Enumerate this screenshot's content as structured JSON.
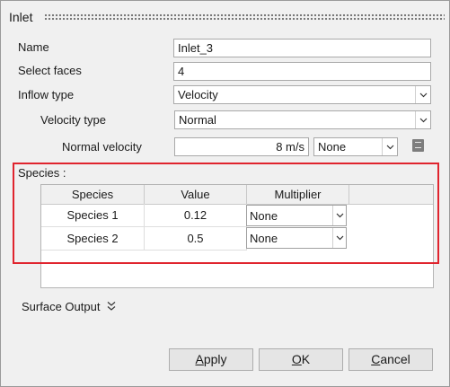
{
  "dialog": {
    "title": "Inlet"
  },
  "form": {
    "name_label": "Name",
    "name_value": "Inlet_3",
    "select_faces_label": "Select faces",
    "select_faces_value": "4",
    "inflow_type_label": "Inflow type",
    "inflow_type_value": "Velocity",
    "velocity_type_label": "Velocity type",
    "velocity_type_value": "Normal",
    "normal_velocity_label": "Normal velocity",
    "normal_velocity_value": "8 m/s",
    "normal_velocity_ref": "None"
  },
  "species": {
    "section_label": "Species :",
    "columns": [
      "Species",
      "Value",
      "Multiplier"
    ],
    "rows": [
      {
        "species": "Species 1",
        "value": "0.12",
        "multiplier": "None"
      },
      {
        "species": "Species 2",
        "value": "0.5",
        "multiplier": "None"
      }
    ]
  },
  "surface_output": {
    "label": "Surface Output"
  },
  "buttons": {
    "apply_first": "A",
    "apply_rest": "pply",
    "ok_first": "O",
    "ok_rest": "K",
    "cancel_first": "C",
    "cancel_rest": "ancel"
  },
  "colors": {
    "highlight": "#e0242e",
    "background": "#f0f0f0"
  },
  "icons": [
    "grip-icon",
    "chevron-down-icon",
    "units-icon",
    "double-chevron-down-icon"
  ]
}
